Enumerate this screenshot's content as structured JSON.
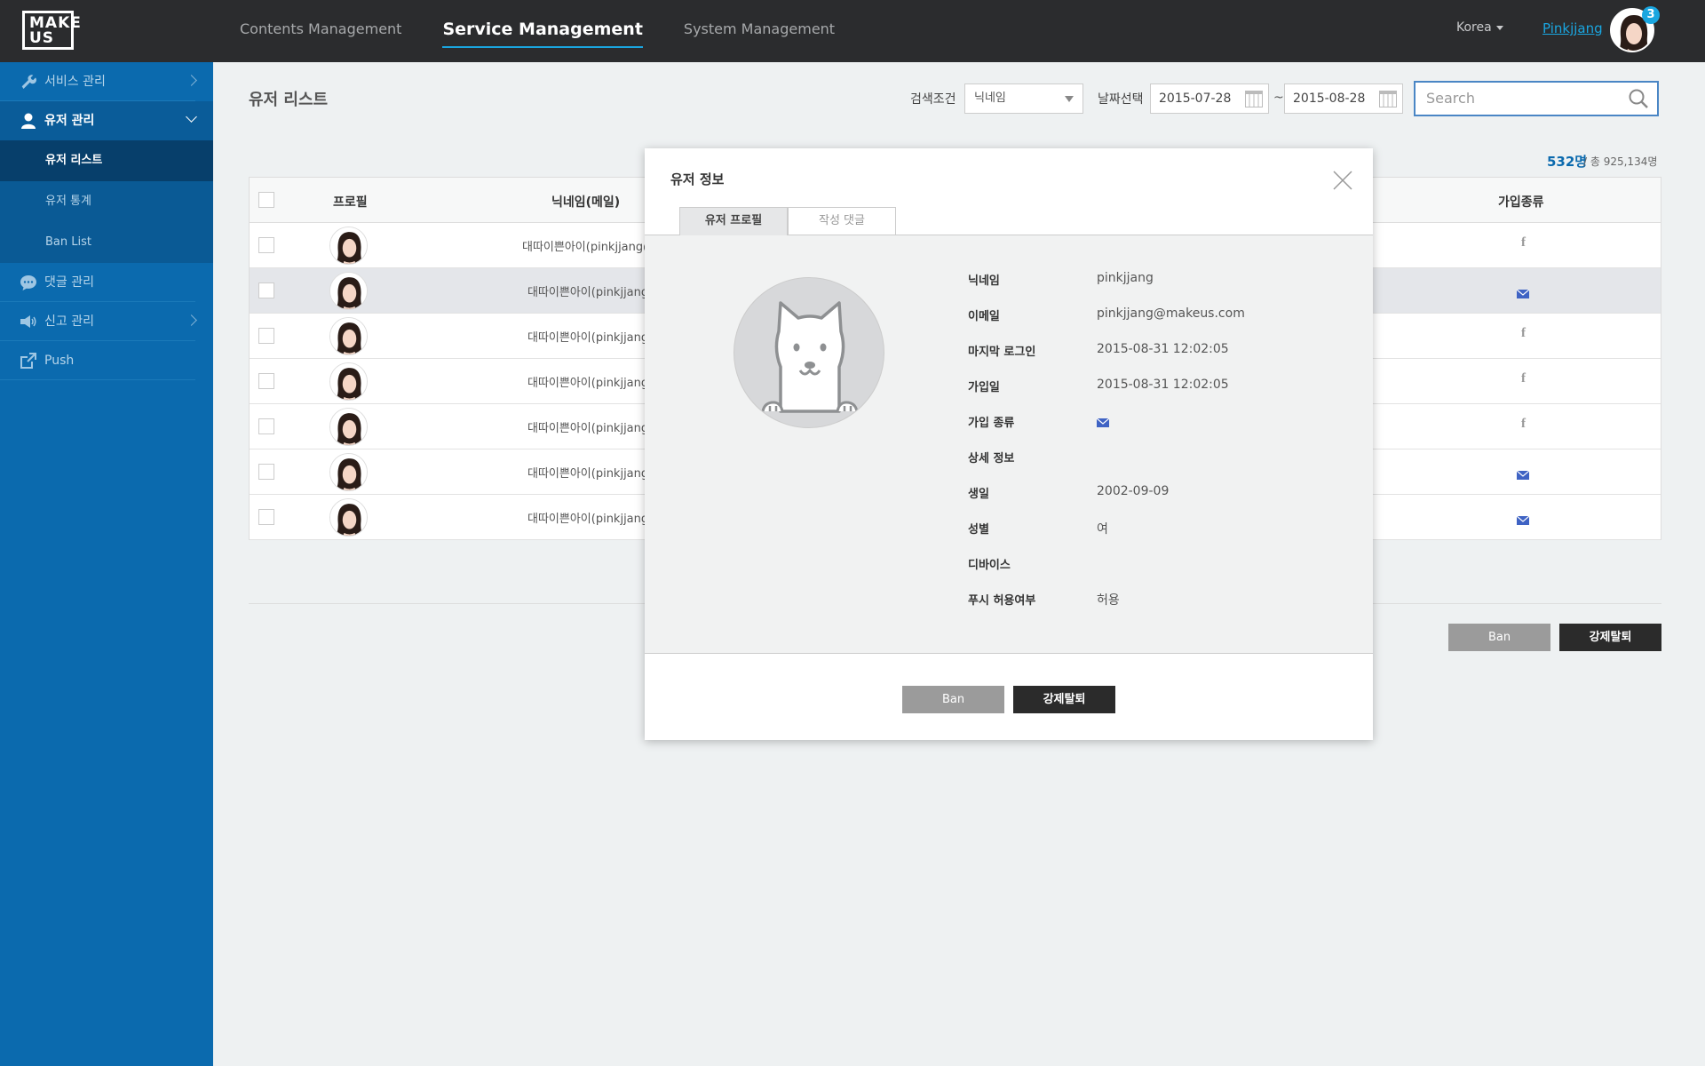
{
  "logo": {
    "line1": "MAKE",
    "line2": "US"
  },
  "topnav": [
    {
      "label": "Contents Management",
      "active": false
    },
    {
      "label": "Service Management",
      "active": true
    },
    {
      "label": "System Management",
      "active": false
    }
  ],
  "header": {
    "country": "Korea",
    "username": "Pinkjjang",
    "notification_count": "3"
  },
  "sidebar": {
    "items": [
      {
        "label": "서비스 관리",
        "icon": "wrench-icon"
      },
      {
        "label": "유저 관리",
        "icon": "user-icon"
      },
      {
        "label": "댓글 관리",
        "icon": "comment-icon"
      },
      {
        "label": "신고 관리",
        "icon": "megaphone-icon"
      },
      {
        "label": "Push",
        "icon": "share-icon"
      }
    ],
    "subitems": [
      {
        "label": "유저 리스트",
        "active": true
      },
      {
        "label": "유저 통계",
        "active": false
      },
      {
        "label": "Ban List",
        "active": false
      }
    ]
  },
  "page": {
    "title": "유저 리스트",
    "search_condition_label": "검색조건",
    "search_condition_value": "닉네임",
    "date_label": "날짜선택",
    "date_from": "2015-07-28",
    "date_sep": "~",
    "date_to": "2015-08-28",
    "search_placeholder": "Search",
    "count": "532명",
    "count_total": "/ 총 925,134명"
  },
  "table": {
    "headers": {
      "profile": "프로필",
      "nickname": "닉네임(메일)",
      "join_type": "가입종류"
    },
    "rows": [
      {
        "nickname": "대따이쁜아이(pinkjjang@",
        "join_type": "facebook",
        "highlight": false
      },
      {
        "nickname": "대따이쁜아이(pinkjjang",
        "join_type": "email",
        "highlight": true
      },
      {
        "nickname": "대따이쁜아이(pinkjjang",
        "join_type": "facebook",
        "highlight": false
      },
      {
        "nickname": "대따이쁜아이(pinkjjang",
        "join_type": "facebook",
        "highlight": false
      },
      {
        "nickname": "대따이쁜아이(pinkjjang",
        "join_type": "facebook",
        "highlight": false
      },
      {
        "nickname": "대따이쁜아이(pinkjjang",
        "join_type": "email",
        "highlight": false
      },
      {
        "nickname": "대따이쁜아이(pinkjjang",
        "join_type": "email",
        "highlight": false
      }
    ]
  },
  "actions": {
    "ban": "Ban",
    "force_withdraw": "강제탈퇴"
  },
  "modal": {
    "title": "유저 정보",
    "tabs": [
      "유저 프로필",
      "작성 댓글"
    ],
    "fields": [
      {
        "key": "닉네임",
        "value": "pinkjjang"
      },
      {
        "key": "이메일",
        "value": "pinkjjang@makeus.com"
      },
      {
        "key": "마지막 로그인",
        "value": "2015-08-31 12:02:05"
      },
      {
        "key": "가입일",
        "value": "2015-08-31 12:02:05"
      },
      {
        "key": "가입 종류",
        "value": ""
      },
      {
        "key": "상세 정보",
        "value": ""
      },
      {
        "key": "생일",
        "value": "2002-09-09"
      },
      {
        "key": "성별",
        "value": "여"
      },
      {
        "key": "디바이스",
        "value": ""
      },
      {
        "key": "푸시 허용여부",
        "value": "허용"
      }
    ],
    "ban_label": "Ban",
    "withdraw_label": "강제탈퇴"
  },
  "colors": {
    "accent": "#1aa6e0",
    "sidebar": "#0b6aae",
    "topbar": "#2b2c2e"
  }
}
